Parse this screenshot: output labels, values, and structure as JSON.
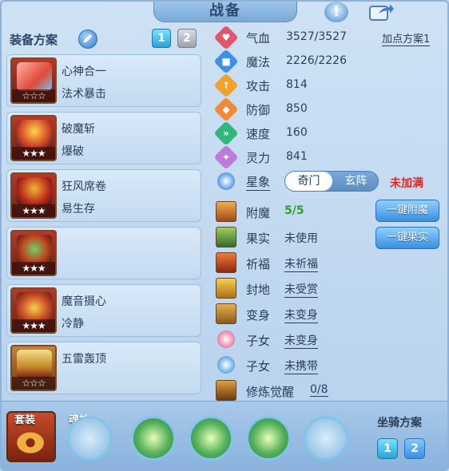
{
  "title": "战备",
  "left": {
    "title": "装备方案",
    "pages": [
      "1",
      "2"
    ],
    "equipment": [
      {
        "name": "心神合一",
        "sub": "法术暴击",
        "stars": "☆☆☆",
        "color": "#d14b3c"
      },
      {
        "name": "破魔斩",
        "sub": "爆破",
        "stars": "★★★",
        "color": "#b3281e"
      },
      {
        "name": "狂风席卷",
        "sub": "易生存",
        "stars": "★★★",
        "color": "#a8261a"
      },
      {
        "name": "",
        "sub": "",
        "stars": "★★★",
        "color": "#8a3a26"
      },
      {
        "name": "魔音摄心",
        "sub": "冷静",
        "stars": "★★★",
        "color": "#c2441c"
      },
      {
        "name": "五雷轰顶",
        "sub": "",
        "stars": "☆☆☆",
        "color": "#b0661e"
      }
    ]
  },
  "stats": {
    "plan_button": "加点方案1",
    "rows": [
      {
        "label": "气血",
        "value": "3527/3527",
        "color": "#e0566a",
        "icon": "heart-icon",
        "glyph": "♥"
      },
      {
        "label": "魔法",
        "value": "2226/2226",
        "color": "#3f8fe6",
        "icon": "mana-icon",
        "glyph": "■"
      },
      {
        "label": "攻击",
        "value": "814",
        "color": "#f0a32c",
        "icon": "attack-icon",
        "glyph": "↑"
      },
      {
        "label": "防御",
        "value": "850",
        "color": "#f08a3a",
        "icon": "defense-icon",
        "glyph": "◆"
      },
      {
        "label": "速度",
        "value": "160",
        "color": "#2fb87a",
        "icon": "speed-icon",
        "glyph": "»"
      },
      {
        "label": "灵力",
        "value": "841",
        "color": "#c07ad8",
        "icon": "spirit-icon",
        "glyph": "✦"
      }
    ]
  },
  "star": {
    "label": "星象",
    "options": [
      "奇门",
      "玄阵"
    ],
    "status": "未加满"
  },
  "extras": [
    {
      "label": "附魔",
      "value": "5/5",
      "style": "green",
      "icon": "enchant-icon",
      "color": "#c7762a"
    },
    {
      "label": "果实",
      "value": "未使用",
      "style": "plain",
      "icon": "fruit-icon",
      "color": "#4a8a3a"
    },
    {
      "label": "祈福",
      "value": "未祈福",
      "style": "ul",
      "icon": "bless-icon",
      "color": "#c2541c"
    },
    {
      "label": "封地",
      "value": "未受赏",
      "style": "ul",
      "icon": "fief-icon",
      "color": "#d09a2a"
    },
    {
      "label": "变身",
      "value": "未变身",
      "style": "ul",
      "icon": "transform-icon",
      "color": "#b8862a"
    },
    {
      "label": "子女",
      "value": "未变身",
      "style": "ul",
      "icon": "child-icon",
      "color": "#e07aa8"
    },
    {
      "label": "子女",
      "value": "未携带",
      "style": "ul",
      "icon": "paw-icon",
      "color": "#4a90e6"
    },
    {
      "label": "修炼觉醒",
      "value": "0/8",
      "style": "ul",
      "icon": "cultivate-icon",
      "color": "#b8862a"
    }
  ],
  "one_key": {
    "enchant": "一键附魔",
    "fruit": "一键果实"
  },
  "bottom": {
    "set_label": "套装",
    "soul_label": "魂技",
    "mount_label": "坐骑方案",
    "mount_pages": [
      "1",
      "2"
    ]
  }
}
